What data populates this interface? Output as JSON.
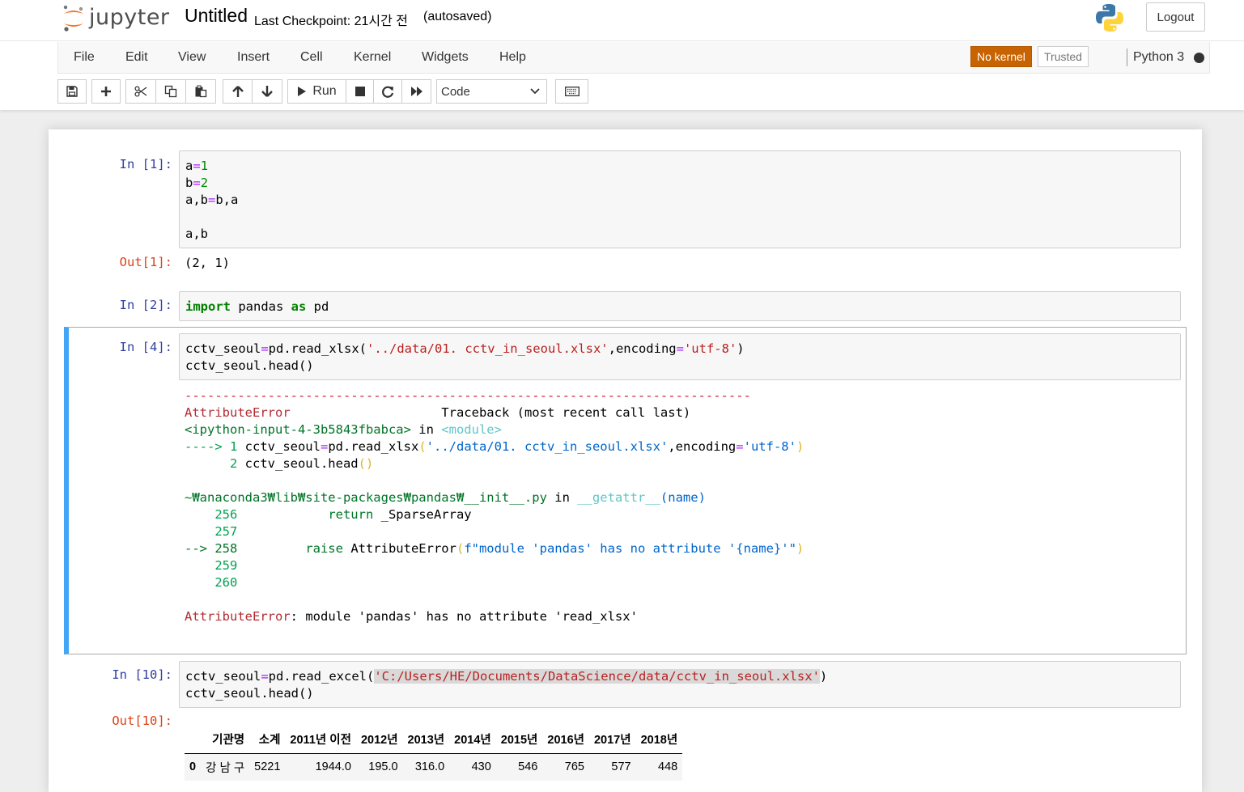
{
  "header": {
    "logo_text": "jupyter",
    "notebook_title": "Untitled",
    "checkpoint": "Last Checkpoint: 21시간 전",
    "autosave": "(autosaved)",
    "logout_label": "Logout"
  },
  "menubar": {
    "items": [
      "File",
      "Edit",
      "View",
      "Insert",
      "Cell",
      "Kernel",
      "Widgets",
      "Help"
    ],
    "kernel_status": "No kernel",
    "trusted": "Trusted",
    "kernel_name": "Python 3"
  },
  "toolbar": {
    "run_label": "Run",
    "cell_type": "Code",
    "icons": [
      "save-icon",
      "plus-icon",
      "cut-icon",
      "copy-icon",
      "paste-icon",
      "arrow-up-icon",
      "arrow-down-icon",
      "play-icon",
      "stop-icon",
      "restart-icon",
      "fast-forward-icon",
      "keyboard-icon"
    ]
  },
  "cells": {
    "c1": {
      "prompt": "In [1]:",
      "out_prompt": "Out[1]:",
      "output": "(2, 1)"
    },
    "c2": {
      "prompt": "In [2]:"
    },
    "c4": {
      "prompt": "In [4]:"
    },
    "c10": {
      "prompt": "In [10]:",
      "out_prompt": "Out[10]:"
    }
  },
  "traceback": {
    "dashes": "---------------------------------------------------------------------------",
    "error_name": "AttributeError",
    "traceback_label": "Traceback (most recent call last)",
    "input_ref": "<ipython-input-4-3b5843fbabca>",
    "in_word": " in ",
    "module_ref": "<module>",
    "file_path": "~₩anaconda3₩lib₩site-packages₩pandas₩__init__.py",
    "func_ref": "__getattr__",
    "func_args": "(name)",
    "final_message": ": module 'pandas' has no attribute 'read_xlsx'"
  },
  "dataframe": {
    "columns": [
      "기관명",
      "소계",
      "2011년 이전",
      "2012년",
      "2013년",
      "2014년",
      "2015년",
      "2016년",
      "2017년",
      "2018년"
    ],
    "rows": [
      [
        "0",
        "강 남 구",
        "5221",
        "1944.0",
        "195.0",
        "316.0",
        "430",
        "546",
        "765",
        "577",
        "448"
      ]
    ]
  }
}
